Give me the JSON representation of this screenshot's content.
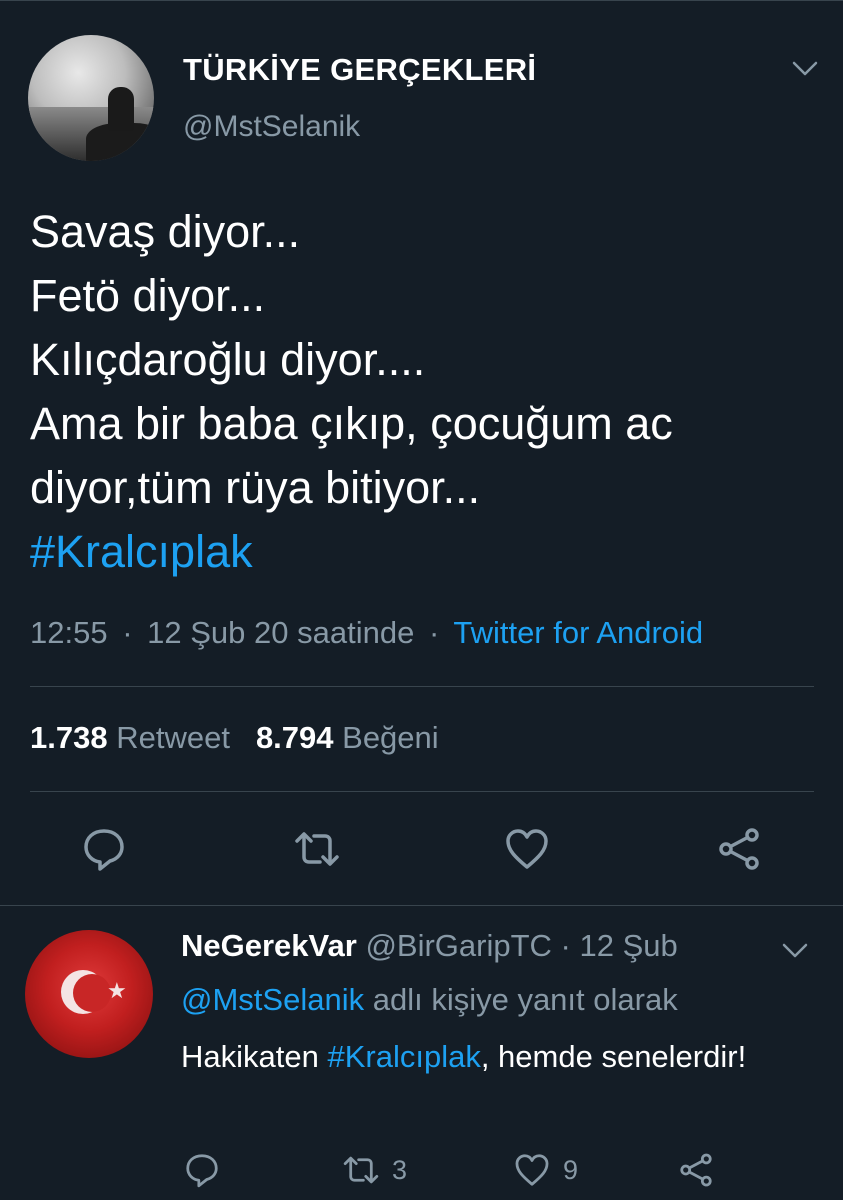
{
  "main_tweet": {
    "display_name": "TÜRKİYE GERÇEKLERİ",
    "handle": "@MstSelanik",
    "text_lines": [
      "Savaş diyor...",
      "Fetö diyor...",
      "Kılıçdaroğlu diyor....",
      "Ama bir baba çıkıp, çocuğum ac",
      "diyor,tüm rüya bitiyor..."
    ],
    "hashtag": "#Kralcıplak",
    "time": "12:55",
    "date": "12 Şub 20 saatinde",
    "separator": "·",
    "source": "Twitter for Android",
    "retweets": "1.738",
    "retweets_label": "Retweet",
    "likes": "8.794",
    "likes_label": "Beğeni",
    "icons": [
      "reply-icon",
      "retweet-icon",
      "like-icon",
      "share-icon"
    ]
  },
  "reply_tweet": {
    "display_name": "NeGerekVar",
    "handle": "@BirGaripTC",
    "separator": "·",
    "date": "12 Şub",
    "reply_to_mention": "@MstSelanik",
    "reply_to_suffix": "adlı kişiye yanıt olarak",
    "text_before": "Hakikaten ",
    "hashtag": "#Kralcıplak",
    "text_after": ", hemde senelerdir!",
    "retweet_count": "3",
    "like_count": "9"
  },
  "colors": {
    "background": "#141d26",
    "text": "#ffffff",
    "secondary": "#8899a6",
    "accent": "#1da1f2",
    "divider": "#38444d"
  }
}
